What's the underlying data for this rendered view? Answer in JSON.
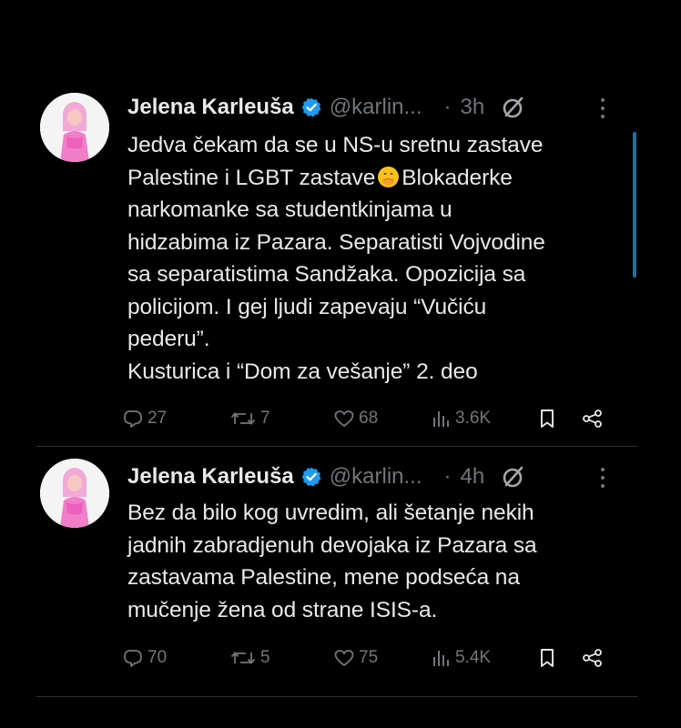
{
  "tweets": [
    {
      "name": "Jelena Karleuša",
      "handle": "@karlin...",
      "separator": "·",
      "time": "3h",
      "text_part1": "Jedva čekam da se u NS-u sretnu zastave\nPalestine i LGBT zastave",
      "emoji": "face-with-hand-over-mouth-emoji",
      "text_part2": "Blokaderke\nnarkomanke sa studentkinjama u\nhidzabima iz Pazara. Separatisti Vojvodine\nsa separatistima Sandžaka. Opozicija sa\npolicijom. I gej ljudi zapevaju “Vučiću\npederu”.\nKusturica i “Dom za vešanje” 2. deo",
      "replies": "27",
      "reposts": "7",
      "likes": "68",
      "views": "3.6K"
    },
    {
      "name": "Jelena Karleuša",
      "handle": "@karlin...",
      "separator": "·",
      "time": "4h",
      "text_part1": "Bez da bilo kog uvredim, ali šetanje nekih\njadnih zabradjenuh devojaka iz Pazara sa\nzastavama Palestine, mene podseća na\nmučenje žena od strane ISIS-a.",
      "replies": "70",
      "reposts": "5",
      "likes": "75",
      "views": "5.4K"
    }
  ],
  "colors": {
    "background": "#000000",
    "text": "#e7e9ea",
    "muted": "#71767b",
    "verified": "#1d9bf0",
    "scrollbar": "#1d6fa5",
    "divider": "#2f3336"
  },
  "icons": [
    "verified-badge-icon",
    "grok-icon",
    "more-icon",
    "reply-icon",
    "repost-icon",
    "like-icon",
    "views-icon",
    "bookmark-icon",
    "share-icon"
  ]
}
